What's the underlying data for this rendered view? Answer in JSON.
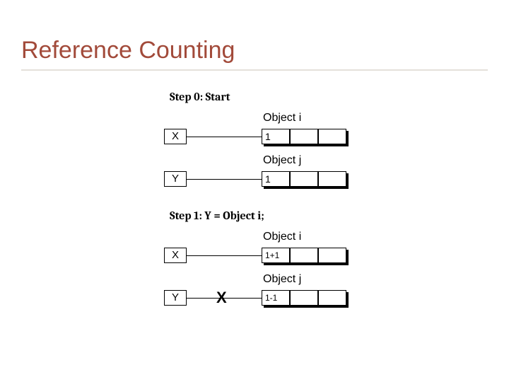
{
  "title": "Reference Counting",
  "step0": {
    "label": "Step 0: Start",
    "varX": "X",
    "varY": "Y",
    "objI": {
      "label": "Object i",
      "count": "1"
    },
    "objJ": {
      "label": "Object j",
      "count": "1"
    }
  },
  "step1": {
    "label": "Step 1: Y = Object i;",
    "varX": "X",
    "varY": "Y",
    "objI": {
      "label": "Object i",
      "count": "1+1"
    },
    "objJ": {
      "label": "Object j",
      "count": "1-1"
    },
    "brokenMark": "X"
  }
}
